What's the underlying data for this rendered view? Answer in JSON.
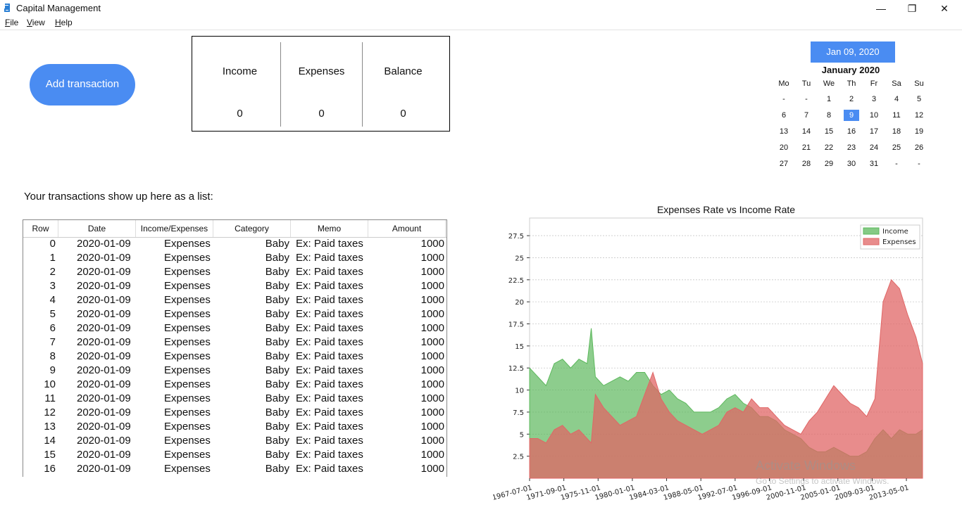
{
  "app": {
    "title": "Capital Management",
    "menu": [
      "File",
      "View",
      "Help"
    ],
    "window_controls": [
      "—",
      "❐",
      "✕"
    ]
  },
  "toolbar": {
    "add_label": "Add transaction"
  },
  "summary": {
    "income_label": "Income",
    "income_value": "0",
    "expenses_label": "Expenses",
    "expenses_value": "0",
    "balance_label": "Balance",
    "balance_value": "0"
  },
  "calendar": {
    "selected_date": "Jan 09, 2020",
    "month_label": "January 2020",
    "weekdays": [
      "Mo",
      "Tu",
      "We",
      "Th",
      "Fr",
      "Sa",
      "Su"
    ],
    "weeks": [
      [
        "-",
        "-",
        "1",
        "2",
        "3",
        "4",
        "5"
      ],
      [
        "6",
        "7",
        "8",
        "9",
        "10",
        "11",
        "12"
      ],
      [
        "13",
        "14",
        "15",
        "16",
        "17",
        "18",
        "19"
      ],
      [
        "20",
        "21",
        "22",
        "23",
        "24",
        "25",
        "26"
      ],
      [
        "27",
        "28",
        "29",
        "30",
        "31",
        "-",
        "-"
      ]
    ],
    "selected_day": "9",
    "accent": "#4a8cf2"
  },
  "transactions": {
    "caption": "Your transactions show up here as a list:",
    "columns": [
      "Row",
      "Date",
      "Income/Expenses",
      "Category",
      "Memo",
      "Amount"
    ],
    "rows": [
      [
        "0",
        "2020-01-09",
        "Expenses",
        "Baby",
        "Ex: Paid taxes",
        "1000"
      ],
      [
        "1",
        "2020-01-09",
        "Expenses",
        "Baby",
        "Ex: Paid taxes",
        "1000"
      ],
      [
        "2",
        "2020-01-09",
        "Expenses",
        "Baby",
        "Ex: Paid taxes",
        "1000"
      ],
      [
        "3",
        "2020-01-09",
        "Expenses",
        "Baby",
        "Ex: Paid taxes",
        "1000"
      ],
      [
        "4",
        "2020-01-09",
        "Expenses",
        "Baby",
        "Ex: Paid taxes",
        "1000"
      ],
      [
        "5",
        "2020-01-09",
        "Expenses",
        "Baby",
        "Ex: Paid taxes",
        "1000"
      ],
      [
        "6",
        "2020-01-09",
        "Expenses",
        "Baby",
        "Ex: Paid taxes",
        "1000"
      ],
      [
        "7",
        "2020-01-09",
        "Expenses",
        "Baby",
        "Ex: Paid taxes",
        "1000"
      ],
      [
        "8",
        "2020-01-09",
        "Expenses",
        "Baby",
        "Ex: Paid taxes",
        "1000"
      ],
      [
        "9",
        "2020-01-09",
        "Expenses",
        "Baby",
        "Ex: Paid taxes",
        "1000"
      ],
      [
        "10",
        "2020-01-09",
        "Expenses",
        "Baby",
        "Ex: Paid taxes",
        "1000"
      ],
      [
        "11",
        "2020-01-09",
        "Expenses",
        "Baby",
        "Ex: Paid taxes",
        "1000"
      ],
      [
        "12",
        "2020-01-09",
        "Expenses",
        "Baby",
        "Ex: Paid taxes",
        "1000"
      ],
      [
        "13",
        "2020-01-09",
        "Expenses",
        "Baby",
        "Ex: Paid taxes",
        "1000"
      ],
      [
        "14",
        "2020-01-09",
        "Expenses",
        "Baby",
        "Ex: Paid taxes",
        "1000"
      ],
      [
        "15",
        "2020-01-09",
        "Expenses",
        "Baby",
        "Ex: Paid taxes",
        "1000"
      ],
      [
        "16",
        "2020-01-09",
        "Expenses",
        "Baby",
        "Ex: Paid taxes",
        "1000"
      ]
    ]
  },
  "chart_data": {
    "type": "area",
    "title": "Expenses Rate vs Income Rate",
    "xlabel": "",
    "ylabel": "",
    "x_tick_labels": [
      "1967-07-01",
      "1971-09-01",
      "1975-11-01",
      "1980-01-01",
      "1984-03-01",
      "1988-05-01",
      "1992-07-01",
      "1996-09-01",
      "2000-11-01",
      "2005-01-01",
      "2009-03-01",
      "2013-05-01"
    ],
    "y_ticks": [
      2.5,
      5.0,
      7.5,
      10.0,
      12.5,
      15.0,
      17.5,
      20.0,
      22.5,
      25.0,
      27.5
    ],
    "ylim": [
      0,
      29.5
    ],
    "xlim": [
      1967.5,
      2015.3
    ],
    "grid": "horizontal",
    "legend_position": "top-right",
    "series": [
      {
        "name": "Income",
        "color": "#5cb85c",
        "x": [
          1967.5,
          1968.5,
          1969.5,
          1970.5,
          1971.5,
          1972.5,
          1973.5,
          1974.5,
          1975.0,
          1975.5,
          1976.5,
          1977.5,
          1978.5,
          1979.5,
          1980.5,
          1981.5,
          1982.5,
          1983.5,
          1984.5,
          1985.5,
          1986.5,
          1987.5,
          1988.5,
          1989.5,
          1990.5,
          1991.5,
          1992.5,
          1993.5,
          1994.5,
          1995.5,
          1996.5,
          1997.5,
          1998.5,
          1999.5,
          2000.5,
          2001.5,
          2002.5,
          2003.5,
          2004.5,
          2005.5,
          2006.5,
          2007.5,
          2008.5,
          2009.5,
          2010.5,
          2011.5,
          2012.5,
          2013.5,
          2014.5,
          2015.3
        ],
        "values": [
          12.5,
          11.5,
          10.5,
          13.0,
          13.5,
          12.5,
          13.5,
          13.0,
          17.0,
          11.5,
          10.5,
          11.0,
          11.5,
          11.0,
          12.0,
          12.0,
          10.5,
          9.5,
          10.0,
          9.0,
          8.5,
          7.5,
          7.5,
          7.5,
          8.0,
          9.0,
          9.5,
          8.5,
          8.0,
          7.0,
          7.0,
          6.5,
          5.5,
          5.0,
          4.5,
          3.5,
          3.0,
          3.0,
          3.5,
          3.0,
          2.5,
          2.5,
          3.0,
          4.5,
          5.5,
          4.5,
          5.5,
          5.0,
          5.0,
          5.5
        ]
      },
      {
        "name": "Expenses",
        "color": "#e06666",
        "x": [
          1967.5,
          1968.5,
          1969.5,
          1970.5,
          1971.5,
          1972.5,
          1973.5,
          1974.5,
          1975.0,
          1975.5,
          1976.5,
          1977.5,
          1978.5,
          1979.5,
          1980.5,
          1981.5,
          1982.5,
          1983.5,
          1984.5,
          1985.5,
          1986.5,
          1987.5,
          1988.5,
          1989.5,
          1990.5,
          1991.5,
          1992.5,
          1993.5,
          1994.5,
          1995.5,
          1996.5,
          1997.5,
          1998.5,
          1999.5,
          2000.5,
          2001.5,
          2002.5,
          2003.5,
          2004.5,
          2005.5,
          2006.5,
          2007.5,
          2008.5,
          2009.5,
          2010.5,
          2011.5,
          2012.5,
          2013.5,
          2014.5,
          2015.3
        ],
        "values": [
          4.5,
          4.5,
          4.0,
          5.5,
          6.0,
          5.0,
          5.5,
          4.5,
          4.0,
          9.5,
          8.0,
          7.0,
          6.0,
          6.5,
          7.0,
          9.5,
          12.0,
          9.0,
          7.5,
          6.5,
          6.0,
          5.5,
          5.0,
          5.5,
          6.0,
          7.5,
          8.0,
          7.5,
          9.0,
          8.0,
          8.0,
          7.0,
          6.0,
          5.5,
          5.0,
          6.5,
          7.5,
          9.0,
          10.5,
          9.5,
          8.5,
          8.0,
          7.0,
          9.0,
          20.0,
          22.5,
          21.5,
          18.5,
          16.0,
          13.0
        ]
      }
    ]
  },
  "watermark": {
    "line1": "Activate Windows",
    "line2": "Go to Settings to activate Windows."
  }
}
